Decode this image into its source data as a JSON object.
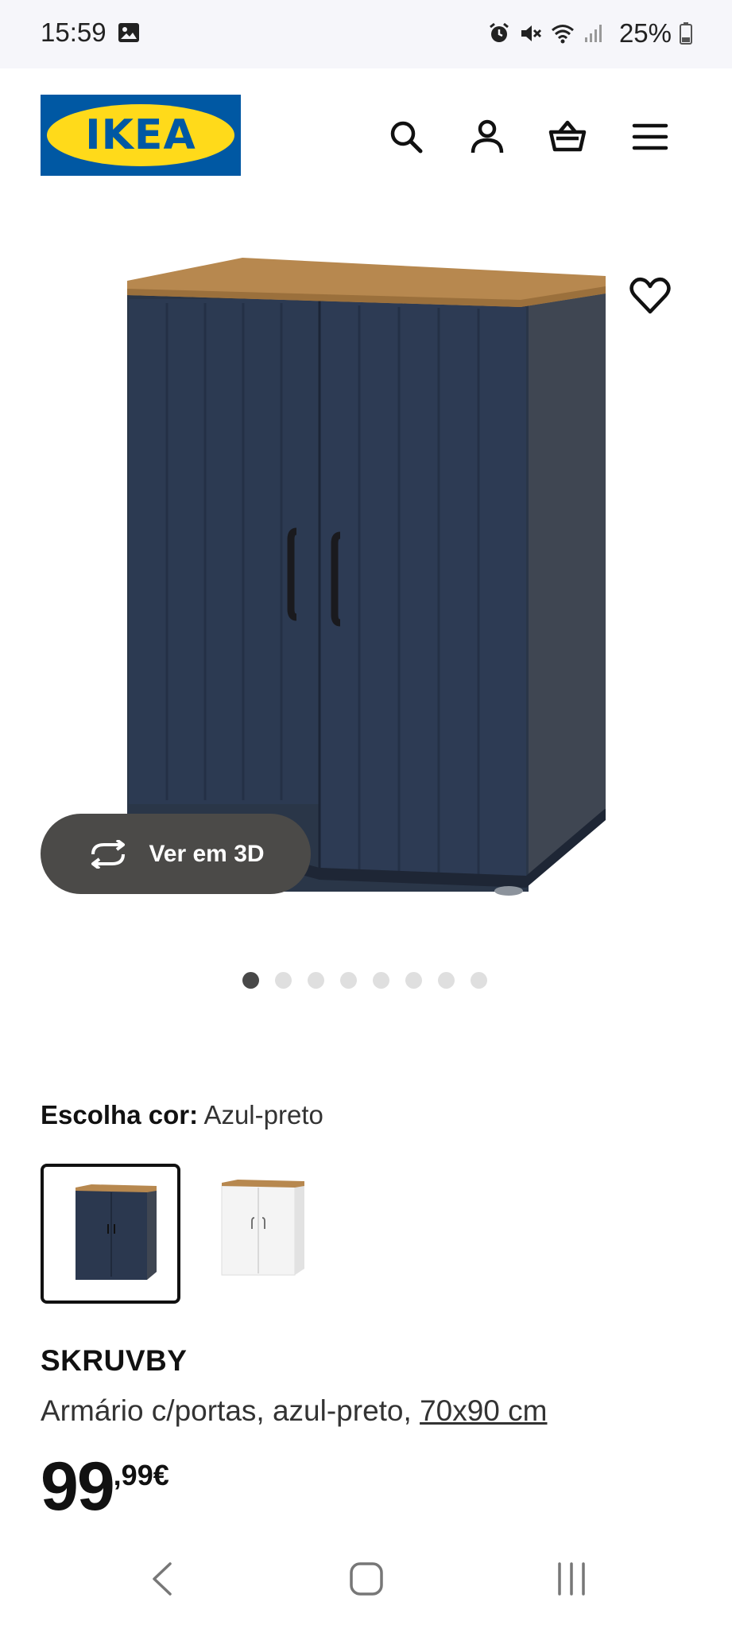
{
  "status_bar": {
    "time": "15:59",
    "battery": "25%",
    "icons": [
      "gallery-icon",
      "alarm-icon",
      "mute-icon",
      "wifi-icon",
      "signal-icon",
      "battery-icon"
    ]
  },
  "header": {
    "logo_text": "IKEA",
    "brand_colors": {
      "blue": "#0058a3",
      "yellow": "#ffda1a"
    },
    "icons": [
      "search-icon",
      "account-icon",
      "cart-icon",
      "menu-icon"
    ]
  },
  "gallery": {
    "button_label": "Ver em 3D",
    "dot_count": 8,
    "active_dot": 0
  },
  "color_choice": {
    "label": "Escolha cor:",
    "value": "Azul-preto",
    "swatches": [
      "Azul-preto",
      "Branco"
    ]
  },
  "product": {
    "name": "SKRUVBY",
    "description": "Armário c/portas, azul-preto,",
    "size_link": "70x90 cm",
    "price_integer": "99",
    "price_decimal": ",99€"
  },
  "navbar": {
    "icons": [
      "back-icon",
      "home-icon",
      "recents-icon"
    ]
  }
}
